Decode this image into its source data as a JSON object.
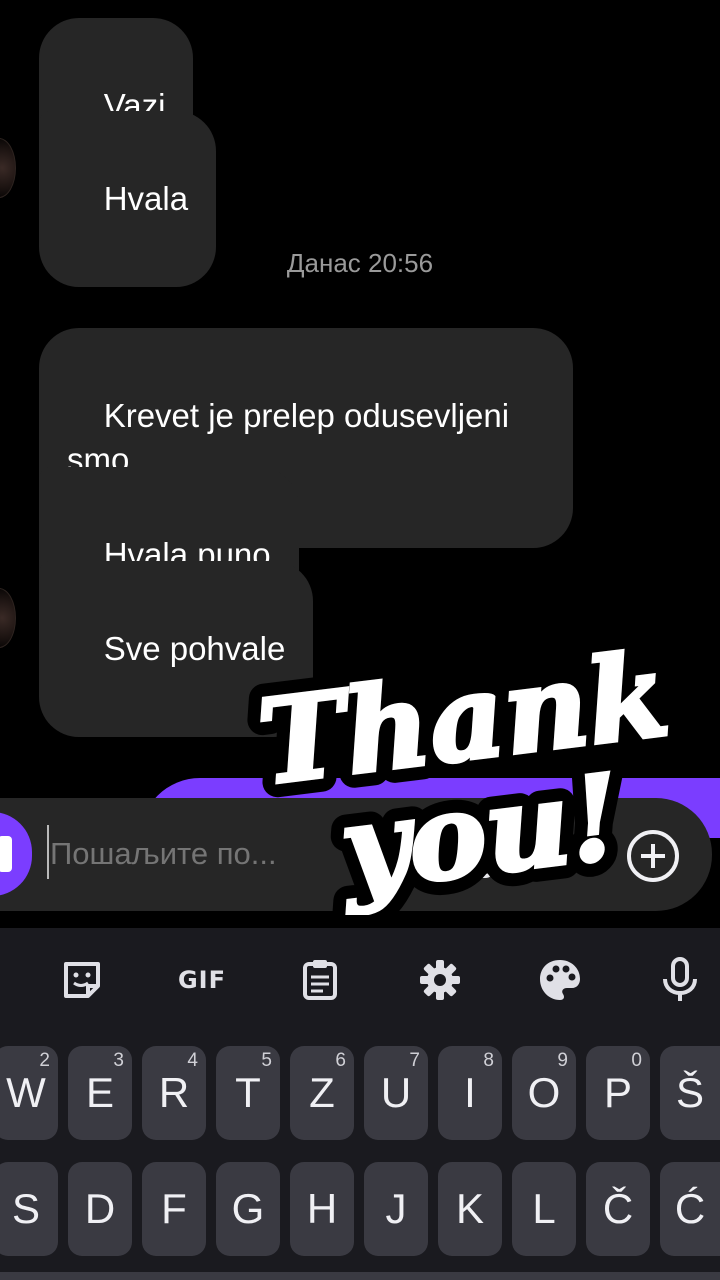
{
  "chat": {
    "messages_group1": [
      "Vazi",
      "Hvala"
    ],
    "timestamp": "Данас 20:56",
    "messages_group2": [
      "Krevet je prelep odusevljeni\nsmo",
      "Hvala puno",
      "Sve pohvale"
    ]
  },
  "composer": {
    "placeholder": "Пошаљите по...",
    "icons": [
      "image-icon",
      "chat-bubble-icon",
      "add-circle-icon"
    ],
    "accent_color": "#7b3dff"
  },
  "sticker": {
    "line1": "Thank",
    "line2": "you!"
  },
  "keyboard": {
    "toolbar": {
      "gif_label": "GIF",
      "icons": [
        "sticker-icon",
        "gif-icon",
        "clipboard-icon",
        "settings-icon",
        "palette-icon",
        "mic-icon"
      ]
    },
    "row1": [
      {
        "label": "W",
        "hint": "2"
      },
      {
        "label": "E",
        "hint": "3"
      },
      {
        "label": "R",
        "hint": "4"
      },
      {
        "label": "T",
        "hint": "5"
      },
      {
        "label": "Z",
        "hint": "6"
      },
      {
        "label": "U",
        "hint": "7"
      },
      {
        "label": "I",
        "hint": "8"
      },
      {
        "label": "O",
        "hint": "9"
      },
      {
        "label": "P",
        "hint": "0"
      },
      {
        "label": "Š",
        "hint": ""
      }
    ],
    "row2": [
      {
        "label": "S"
      },
      {
        "label": "D"
      },
      {
        "label": "F"
      },
      {
        "label": "G"
      },
      {
        "label": "H"
      },
      {
        "label": "J"
      },
      {
        "label": "K"
      },
      {
        "label": "L"
      },
      {
        "label": "Č"
      },
      {
        "label": "Ć"
      }
    ]
  }
}
